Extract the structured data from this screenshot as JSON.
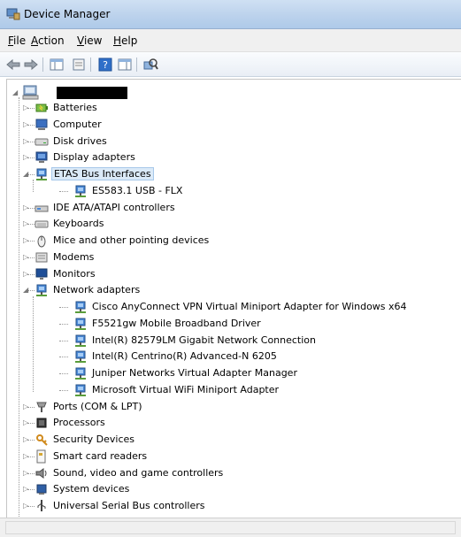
{
  "window": {
    "title": "Device Manager"
  },
  "menu": [
    {
      "underline": "F",
      "rest": "ile"
    },
    {
      "underline": "A",
      "rest": "ction"
    },
    {
      "underline": "V",
      "rest": "iew"
    },
    {
      "underline": "H",
      "rest": "elp"
    }
  ],
  "tree": {
    "root": {
      "label": ""
    },
    "categories": [
      {
        "label": "Batteries",
        "icon": "battery-icon",
        "expanded": false
      },
      {
        "label": "Computer",
        "icon": "computer-icon",
        "expanded": false
      },
      {
        "label": "Disk drives",
        "icon": "disk-drive-icon",
        "expanded": false
      },
      {
        "label": "Display adapters",
        "icon": "display-icon",
        "expanded": false
      },
      {
        "label": "ETAS Bus Interfaces",
        "icon": "network-icon",
        "expanded": true,
        "selected": true,
        "children": [
          {
            "label": "ES583.1 USB - FLX",
            "icon": "network-icon"
          }
        ]
      },
      {
        "label": "IDE ATA/ATAPI controllers",
        "icon": "controller-icon",
        "expanded": false
      },
      {
        "label": "Keyboards",
        "icon": "keyboard-icon",
        "expanded": false
      },
      {
        "label": "Mice and other pointing devices",
        "icon": "mouse-icon",
        "expanded": false
      },
      {
        "label": "Modems",
        "icon": "modem-icon",
        "expanded": false
      },
      {
        "label": "Monitors",
        "icon": "monitor-icon",
        "expanded": false
      },
      {
        "label": "Network adapters",
        "icon": "network-icon",
        "expanded": true,
        "children": [
          {
            "label": "Cisco AnyConnect VPN Virtual Miniport Adapter for Windows x64",
            "icon": "network-icon"
          },
          {
            "label": "F5521gw Mobile Broadband Driver",
            "icon": "network-icon"
          },
          {
            "label": "Intel(R) 82579LM Gigabit Network Connection",
            "icon": "network-icon"
          },
          {
            "label": "Intel(R) Centrino(R) Advanced-N 6205",
            "icon": "network-icon"
          },
          {
            "label": "Juniper Networks Virtual Adapter Manager",
            "icon": "network-icon"
          },
          {
            "label": "Microsoft Virtual WiFi Miniport Adapter",
            "icon": "network-icon"
          }
        ]
      },
      {
        "label": "Ports (COM & LPT)",
        "icon": "port-icon",
        "expanded": false
      },
      {
        "label": "Processors",
        "icon": "processor-icon",
        "expanded": false
      },
      {
        "label": "Security Devices",
        "icon": "security-icon",
        "expanded": false
      },
      {
        "label": "Smart card readers",
        "icon": "smartcard-icon",
        "expanded": false
      },
      {
        "label": "Sound, video and game controllers",
        "icon": "sound-icon",
        "expanded": false
      },
      {
        "label": "System devices",
        "icon": "system-icon",
        "expanded": false
      },
      {
        "label": "Universal Serial Bus controllers",
        "icon": "usb-icon",
        "expanded": false
      }
    ]
  }
}
